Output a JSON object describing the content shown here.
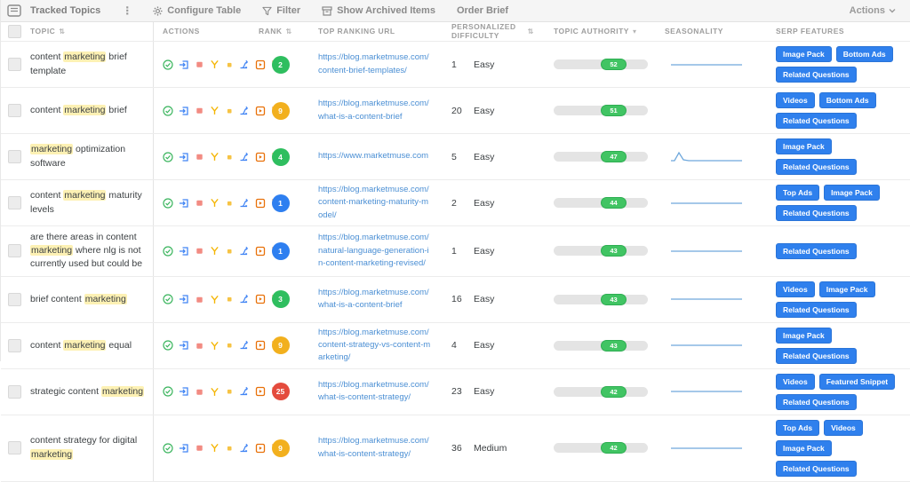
{
  "toolbar": {
    "title": "Tracked Topics",
    "configure_label": "Configure Table",
    "filter_label": "Filter",
    "archived_label": "Show Archived Items",
    "order_brief_label": "Order Brief",
    "actions_label": "Actions",
    "icons": [
      "panel-icon",
      "kebab-menu-icon",
      "gear-icon",
      "filter-funnel-icon",
      "archive-icon",
      "chevron-down-icon"
    ]
  },
  "table": {
    "columns": {
      "topic": "Topic",
      "actions": "Actions",
      "rank": "Rank",
      "url": "Top Ranking URL",
      "difficulty_line1": "Personalized",
      "difficulty_line2": "Difficulty",
      "authority": "Topic Authority",
      "seasonality": "Seasonality",
      "serp": "SERP Features"
    },
    "sort_icons": {
      "topic": "both",
      "rank": "both",
      "difficulty": "both",
      "authority": "desc"
    },
    "action_icons": [
      "check-circle",
      "export-box",
      "tag-square",
      "funnel",
      "dot-square",
      "branch",
      "brief-box",
      "copy"
    ],
    "rows": [
      {
        "topic_pre": "content ",
        "topic_hl": "marketing",
        "topic_post": " brief template",
        "rank": "2",
        "rank_color": "green",
        "url": "https://blog.marketmuse.com/content-brief-templates/",
        "difficulty": "1",
        "difficulty_level": "Easy",
        "authority": "52",
        "seasonality": "flat",
        "serp": [
          "Image Pack",
          "Bottom Ads",
          "Related Questions"
        ]
      },
      {
        "topic_pre": "content ",
        "topic_hl": "marketing",
        "topic_post": " brief",
        "rank": "9",
        "rank_color": "yellow",
        "url": "https://blog.marketmuse.com/what-is-a-content-brief",
        "difficulty": "20",
        "difficulty_level": "Easy",
        "authority": "51",
        "seasonality": "none",
        "serp": [
          "Videos",
          "Bottom Ads",
          "Related Questions"
        ]
      },
      {
        "topic_pre": "",
        "topic_hl": "marketing",
        "topic_post": " optimization software",
        "rank": "4",
        "rank_color": "green",
        "url": "https://www.marketmuse.com",
        "difficulty": "5",
        "difficulty_level": "Easy",
        "authority": "47",
        "seasonality": "spike",
        "serp": [
          "Image Pack",
          "Related Questions"
        ]
      },
      {
        "topic_pre": "content ",
        "topic_hl": "marketing",
        "topic_post": " maturity levels",
        "rank": "1",
        "rank_color": "blue",
        "url": "https://blog.marketmuse.com/content-marketing-maturity-model/",
        "difficulty": "2",
        "difficulty_level": "Easy",
        "authority": "44",
        "seasonality": "flat",
        "serp": [
          "Top Ads",
          "Image Pack",
          "Related Questions"
        ]
      },
      {
        "topic_pre": "are there areas in content ",
        "topic_hl": "marketing",
        "topic_post": " where nlg is not currently used but could be",
        "rank": "1",
        "rank_color": "blue",
        "url": "https://blog.marketmuse.com/natural-language-generation-in-content-marketing-revised/",
        "difficulty": "1",
        "difficulty_level": "Easy",
        "authority": "43",
        "seasonality": "flat",
        "serp": [
          "Related Questions"
        ]
      },
      {
        "topic_pre": "brief content ",
        "topic_hl": "marketing",
        "topic_post": "",
        "rank": "3",
        "rank_color": "green",
        "url": "https://blog.marketmuse.com/what-is-a-content-brief",
        "difficulty": "16",
        "difficulty_level": "Easy",
        "authority": "43",
        "seasonality": "flat",
        "serp": [
          "Videos",
          "Image Pack",
          "Related Questions"
        ]
      },
      {
        "topic_pre": "content ",
        "topic_hl": "marketing",
        "topic_post": " equal",
        "rank": "9",
        "rank_color": "yellow",
        "url": "https://blog.marketmuse.com/content-strategy-vs-content-marketing/",
        "difficulty": "4",
        "difficulty_level": "Easy",
        "authority": "43",
        "seasonality": "flat",
        "serp": [
          "Image Pack",
          "Related Questions"
        ]
      },
      {
        "topic_pre": "strategic content ",
        "topic_hl": "marketing",
        "topic_post": "",
        "rank": "25",
        "rank_color": "red",
        "url": "https://blog.marketmuse.com/what-is-content-strategy/",
        "difficulty": "23",
        "difficulty_level": "Easy",
        "authority": "42",
        "seasonality": "flat",
        "serp": [
          "Videos",
          "Featured Snippet",
          "Related Questions"
        ]
      },
      {
        "topic_pre": "content strategy for digital ",
        "topic_hl": "marketing",
        "topic_post": "",
        "rank": "9",
        "rank_color": "yellow",
        "url": "https://blog.marketmuse.com/what-is-content-strategy/",
        "difficulty": "36",
        "difficulty_level": "Medium",
        "authority": "42",
        "seasonality": "flat",
        "serp": [
          "Top Ads",
          "Videos",
          "Image Pack",
          "Related Questions"
        ]
      }
    ]
  },
  "colors": {
    "accent_blue": "#2f80ed",
    "link_blue": "#4b8fd4",
    "authority_green": "#41c463",
    "rank_green": "#2fbe5f",
    "rank_yellow": "#f2b01e",
    "rank_blue": "#2e7ff0",
    "rank_red": "#e44b3d",
    "highlight_yellow": "#fdf1b4"
  }
}
